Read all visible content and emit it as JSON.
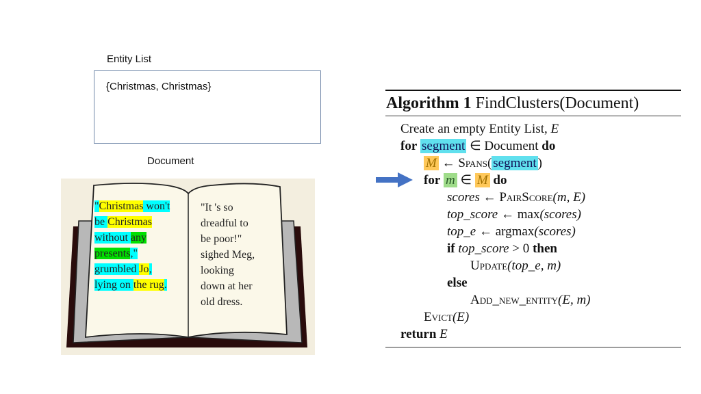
{
  "entity_list": {
    "label": "Entity List",
    "value": "{Christmas, Christmas}"
  },
  "document": {
    "label": "Document",
    "left_page": [
      [
        {
          "t": "\"",
          "h": "c"
        },
        {
          "t": "Christmas",
          "h": "y"
        },
        {
          "t": " won't",
          "h": "c"
        }
      ],
      [
        {
          "t": "be ",
          "h": "c"
        },
        {
          "t": "Christmas",
          "h": "y"
        },
        {
          "t": " ",
          "h": "c"
        }
      ],
      [
        {
          "t": "without ",
          "h": "c"
        },
        {
          "t": "any",
          "h": "g"
        }
      ],
      [
        {
          "t": "presents",
          "h": "g"
        },
        {
          "t": ",\"",
          "h": "c"
        }
      ],
      [
        {
          "t": "grumbled ",
          "h": "c"
        },
        {
          "t": "Jo",
          "h": "y"
        },
        {
          "t": ",",
          "h": "c"
        }
      ],
      [
        {
          "t": "lying on ",
          "h": "c"
        },
        {
          "t": "the rug",
          "h": "y"
        },
        {
          "t": ".",
          "h": "c"
        }
      ]
    ],
    "right_page": [
      "\"It 's so",
      "dreadful to",
      "be poor!\"",
      "sighed Meg,",
      "looking",
      "down at her",
      "old dress."
    ],
    "highlight_colors": {
      "c": "#00ffff",
      "y": "#ffff00",
      "g": "#00e000"
    }
  },
  "algorithm": {
    "title_bold": "Algorithm 1",
    "title_rest": "FindClusters(Document)",
    "lines": {
      "l1": "Create an empty Entity List, ",
      "l1_var": "E",
      "for": "for",
      "segment": "segment",
      "in_doc": " ∈ Document ",
      "do": "do",
      "M": "M",
      "larrow": " ← ",
      "spans": "Spans",
      "m": "m",
      "in": " ∈ ",
      "scores": "scores",
      "pairscore": "PairScore",
      "pair_args": "(m, E)",
      "top_score": "top_score",
      "max": "max",
      "scores_arg": "(scores)",
      "top_e": "top_e",
      "argmax": "argmax",
      "if": "if",
      "gt0": " > 0 ",
      "then": "then",
      "update": "Update",
      "update_args": "(top_e, m)",
      "else": "else",
      "add_new": "Add_new_entity",
      "add_args": "(E, m)",
      "evict": "Evict",
      "evict_args": "(E)",
      "return": "return",
      "E": "E"
    },
    "pointer": "arrow pointing to 'for m ∈ M do'",
    "colors": {
      "arrow": "#4472c4",
      "cyan": "#60e0ee",
      "orange": "#ffc85a",
      "green": "#9fdc8a"
    }
  }
}
